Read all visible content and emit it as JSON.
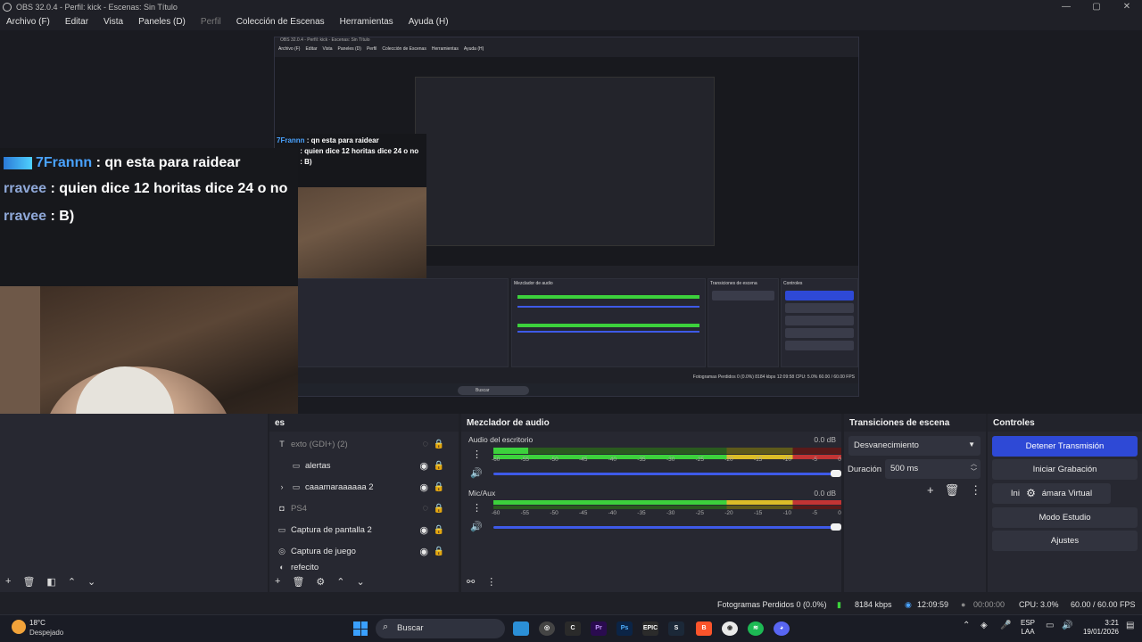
{
  "window": {
    "title": "OBS 32.0.4 - Perfil: kick - Escenas: Sin Título",
    "minimize": "—",
    "maximize": "▢",
    "close": "✕"
  },
  "menu": {
    "items": [
      "Archivo (F)",
      "Editar",
      "Vista",
      "Paneles (D)",
      "Perfil",
      "Colección de Escenas",
      "Herramientas",
      "Ayuda (H)"
    ]
  },
  "preview": {
    "chat": [
      {
        "user": "7Frannn",
        "text": " : qn esta para raidear"
      },
      {
        "user": "rravee",
        "text": " : quien dice 12 horitas dice 24 o no"
      },
      {
        "user": "rravee",
        "text": " : B)"
      }
    ],
    "nested_title": "OBS 32.0.4 - Perfil: kick - Escenas: Sin Título",
    "nested_menu": [
      "Archivo (F)",
      "Editar",
      "Vista",
      "Paneles (D)",
      "Perfil",
      "Colección de Escenas",
      "Herramientas",
      "Ayuda (H)"
    ],
    "nested_mixer_title": "Mezclador de audio",
    "nested_trans_title": "Transiciones de escena",
    "nested_ctrl_title": "Controles",
    "nested_status": "Fotogramas Perdidos 0 (0.0%)   8184 kbps   12:09:58   CPU: 5.0%   60.00 / 60.00 FPS",
    "nested_search": "Buscar"
  },
  "sources": {
    "header": "es",
    "items": [
      {
        "label": "exto (GDI+) (2)",
        "icon": "text-icon",
        "visible": false,
        "dim": true
      },
      {
        "label": "alertas",
        "icon": "folder-icon",
        "visible": true,
        "dim": false
      },
      {
        "label": "caaamaraaaaaa 2",
        "icon": "folder-icon",
        "visible": true,
        "dim": false
      },
      {
        "label": "PS4",
        "icon": "camera-icon",
        "visible": false,
        "dim": true
      },
      {
        "label": "Captura de pantalla 2",
        "icon": "monitor-icon",
        "visible": true,
        "dim": false
      },
      {
        "label": "Captura de juego",
        "icon": "gamepad-icon",
        "visible": true,
        "dim": false
      },
      {
        "label": "refecito",
        "icon": "image-icon",
        "visible": true,
        "dim": false
      }
    ]
  },
  "mixer": {
    "header": "Mezclador de audio",
    "tracks": [
      {
        "name": "Audio del escritorio",
        "db": "0.0 dB",
        "level": 0.1,
        "volume": 1.0
      },
      {
        "name": "Mic/Aux",
        "db": "0.0 dB",
        "level": 0.0,
        "volume": 1.0
      }
    ],
    "scale": [
      "-60",
      "-55",
      "-50",
      "-45",
      "-40",
      "-35",
      "-30",
      "-25",
      "-20",
      "-15",
      "-10",
      "-5",
      "0"
    ]
  },
  "transitions": {
    "header": "Transiciones de escena",
    "selected": "Desvanecimiento",
    "duration_label": "Duración",
    "duration_value": "500 ms"
  },
  "controls": {
    "header": "Controles",
    "stop_stream": "Detener Transmisión",
    "start_record": "Iniciar Grabación",
    "virtual_cam": "Iniciar Cámara Virtual",
    "studio_mode": "Modo Estudio",
    "settings": "Ajustes"
  },
  "status": {
    "dropped": "Fotogramas Perdidos 0 (0.0%)",
    "bitrate": "8184 kbps",
    "stream_time": "12:09:59",
    "record_time": "00:00:00",
    "cpu": "CPU: 3.0%",
    "fps": "60.00 / 60.00 FPS"
  },
  "taskbar": {
    "temp": "18°C",
    "weather": "Despejado",
    "search_placeholder": "Buscar",
    "lang_top": "ESP",
    "lang_bottom": "LAA",
    "time": "3:21",
    "date": "19/01/2026"
  },
  "colors": {
    "accent": "#2e49d6",
    "panel": "#272831",
    "background": "#1f2027"
  }
}
